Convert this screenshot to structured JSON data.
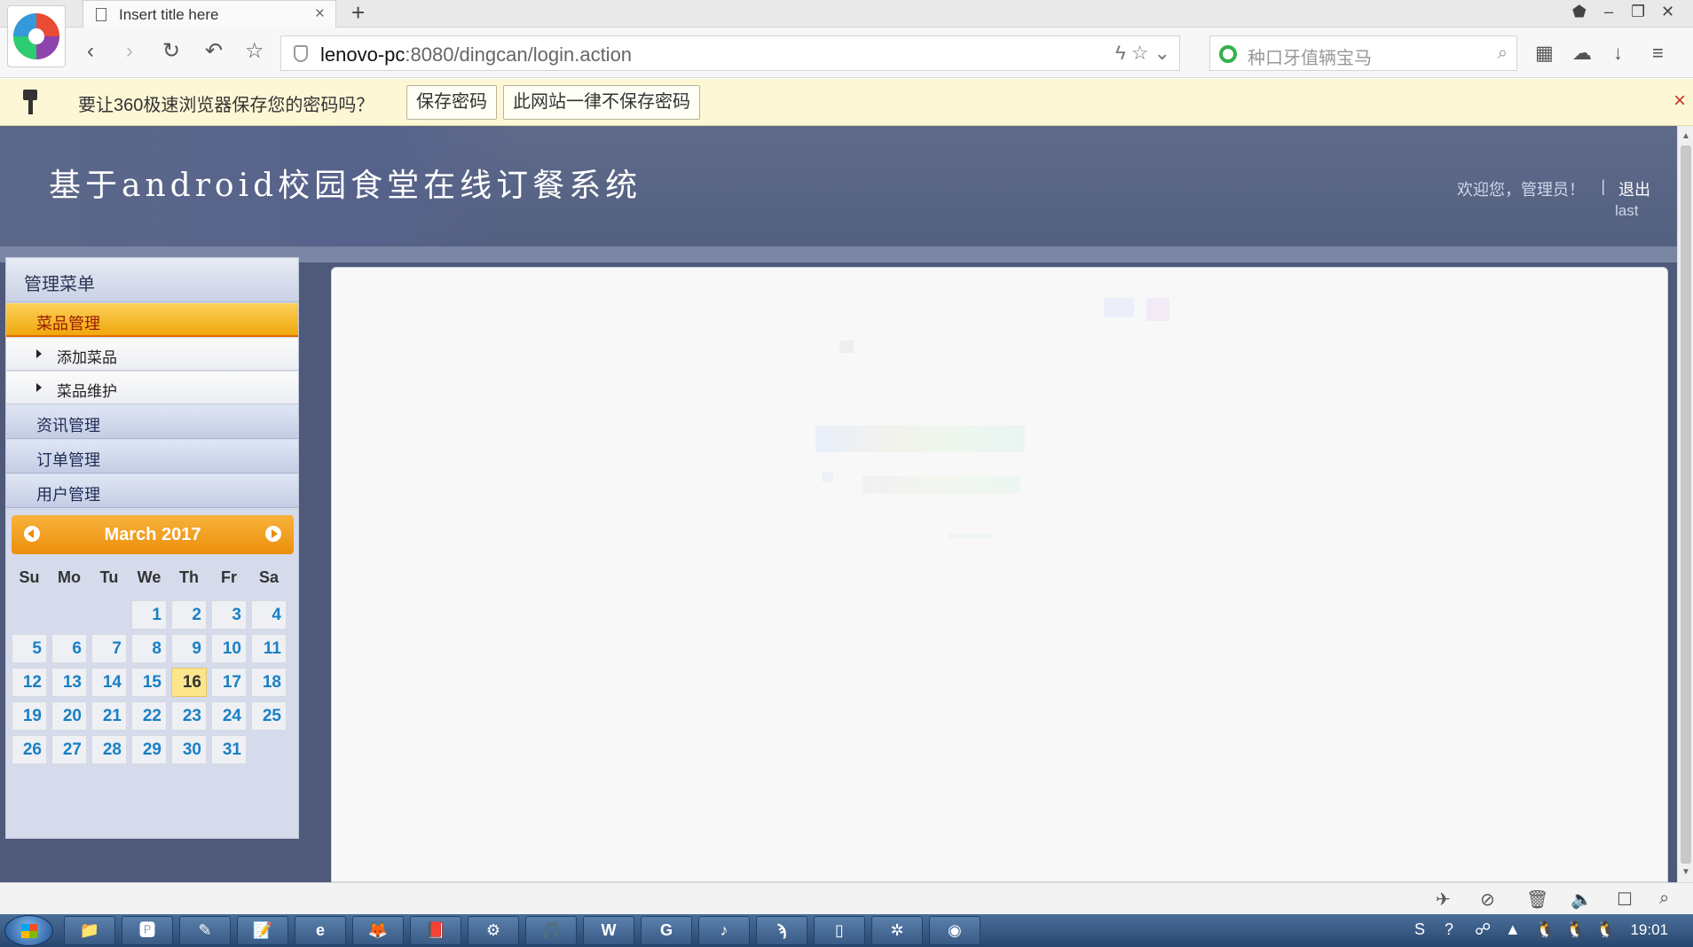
{
  "browser": {
    "tab_title": "Insert title here",
    "tab_close": "×",
    "new_tab": "+",
    "url_host": "lenovo-pc",
    "url_rest": ":8080/dingcan/login.action",
    "search_placeholder": "种口牙值辆宝马",
    "nav": {
      "back": "‹",
      "forward": "›",
      "reload": "↻",
      "undo": "↶",
      "star": "☆"
    },
    "window": {
      "pin": "⬟",
      "minimize": "–",
      "restore": "❐",
      "close": "✕"
    },
    "url_icons": "ϟ ☆ ⌄",
    "tools": {
      "grid": "▦",
      "cloud": "☁",
      "download": "↓",
      "menu": "≡"
    }
  },
  "password_bar": {
    "prompt": "要让360极速浏览器保存您的密码吗？",
    "save_label": "保存密码",
    "never_label": "此网站一律不保存密码",
    "close": "×"
  },
  "header": {
    "site_title": "基于android校园食堂在线订餐系统",
    "welcome": "欢迎您，管理员！",
    "separator": "|",
    "logout": "退出",
    "last_login": "last"
  },
  "sidebar": {
    "title": "管理菜单",
    "active_item": "菜品管理",
    "sub_items": [
      "添加菜品",
      "菜品维护"
    ],
    "items": [
      "资讯管理",
      "订单管理",
      "用户管理"
    ]
  },
  "calendar": {
    "month_label": "March 2017",
    "weekdays": [
      "Su",
      "Mo",
      "Tu",
      "We",
      "Th",
      "Fr",
      "Sa"
    ],
    "first_weekday": 3,
    "days": 31,
    "today": "16"
  },
  "status_icons": [
    "✈",
    "⊘",
    "🗑",
    "🔈",
    "☐",
    "⌕"
  ],
  "taskbar": {
    "apps": [
      "📁",
      "🅿",
      "✎",
      "📝",
      "e",
      "🦊",
      "📕",
      "⚙",
      "🎵",
      "W",
      "G",
      "♪",
      "ϡ",
      "▯",
      "✲",
      "◉"
    ],
    "tray": [
      "S",
      "?",
      "☍",
      "▲",
      "🐧",
      "🐧",
      "🐧"
    ],
    "clock": "19:01"
  },
  "colors": {
    "header_bg": "#5f6a8b",
    "active_menu": "#f0a70c",
    "calendar_head": "#ec8f0c",
    "calendar_day": "#1b7fc4",
    "today_bg": "#fde58a"
  }
}
